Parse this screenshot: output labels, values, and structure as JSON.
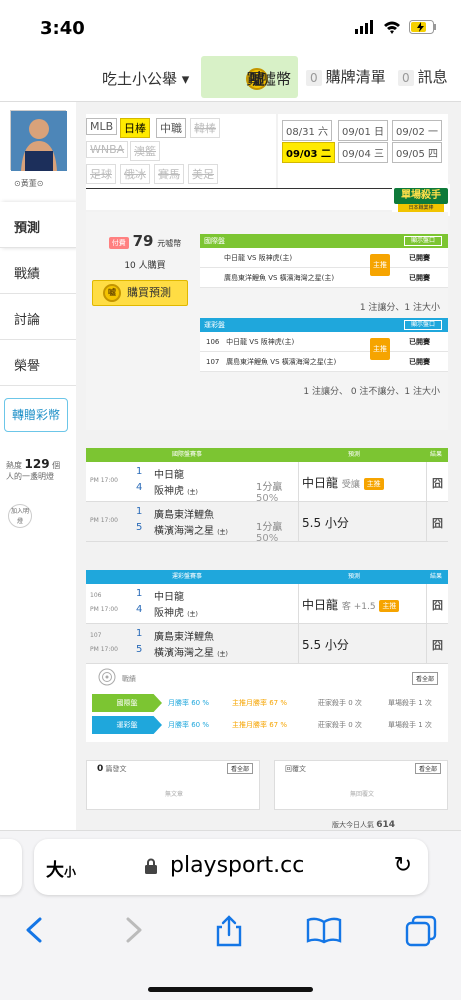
{
  "status": {
    "time": "3:40"
  },
  "topnav": {
    "user": "吃土小公舉 ▾",
    "buy": "買噓幣",
    "cart_count": "0",
    "cart": "購牌清單",
    "msg_count": "0",
    "msg": "訊息",
    "coin_label": "噓"
  },
  "profile": {
    "name": "⊙黃董⊙"
  },
  "sidenav": [
    "預測",
    "戰績",
    "討論",
    "榮譽"
  ],
  "gift": "轉贈彩幣",
  "popularity": {
    "label_pre": "熱度",
    "value": "129",
    "label_post": "個人的一盞明燈",
    "add": "加入明燈"
  },
  "leagues": [
    {
      "label": "MLB",
      "state": "normal"
    },
    {
      "label": "日棒",
      "state": "selected"
    },
    {
      "label": "中職",
      "state": "normal"
    },
    {
      "label": "韓棒",
      "state": "disabled"
    },
    {
      "label": "WNBA",
      "state": "disabled"
    },
    {
      "label": "澳籃",
      "state": "disabled"
    },
    {
      "label": "足球",
      "state": "disabled"
    },
    {
      "label": "俄冰",
      "state": "disabled"
    },
    {
      "label": "賽馬",
      "state": "disabled"
    },
    {
      "label": "美足",
      "state": "disabled"
    }
  ],
  "dates": [
    {
      "label": "08/31 六",
      "selected": false
    },
    {
      "label": "09/01 日",
      "selected": false
    },
    {
      "label": "09/02 一",
      "selected": false
    },
    {
      "label": "09/03 二",
      "selected": true
    },
    {
      "label": "09/04 三",
      "selected": false
    },
    {
      "label": "09/05 四",
      "selected": false
    }
  ],
  "mvp": {
    "title": "單場殺手",
    "sub": "日本職業棒"
  },
  "prediction": {
    "tag": "付費",
    "price": "79",
    "price_unit": "元噓幣",
    "buyers": "10 人購買",
    "buy_button": "購買預測",
    "intl": {
      "title": "國際盤",
      "show": "顯示盤口",
      "rows": [
        {
          "match": "中日龍 VS 阪神虎(主)",
          "tag": "主推",
          "status": "已開賽"
        },
        {
          "match": "廣島東洋鯉魚 VS 橫濱海灣之星(主)",
          "tag": "",
          "status": "已開賽"
        }
      ],
      "summary": "1 注讓分、1 注大小"
    },
    "lottery": {
      "title": "運彩盤",
      "show": "顯示盤口",
      "rows": [
        {
          "no": "106",
          "match": "中日龍 VS 阪神虎(主)",
          "tag": "主推",
          "status": "已開賽"
        },
        {
          "no": "107",
          "match": "廣島東洋鯉魚 VS 橫濱海灣之星(主)",
          "tag": "",
          "status": "已開賽"
        }
      ],
      "summary": "1 注讓分、 0 注不讓分、1 注大小"
    }
  },
  "intl_table": {
    "headers": [
      "國際盤賽事",
      "預測",
      "結果"
    ],
    "rows": [
      {
        "time": "PM 17:00",
        "n1": "1",
        "t1": "中日龍",
        "n2": "4",
        "t2": "阪神虎",
        "t2tag": "(主)",
        "r1": "1分贏",
        "r2": "50%",
        "pick": "中日龍",
        "pick_sub": "受讓",
        "pick_tag": "主推",
        "result": "囧"
      },
      {
        "time": "PM 17:00",
        "n1": "1",
        "t1": "廣島東洋鯉魚",
        "n2": "5",
        "t2": "橫濱海灣之星",
        "t2tag": "(主)",
        "r1": "1分贏",
        "r2": "50%",
        "pick": "5.5 小分",
        "pick_sub": "",
        "pick_tag": "",
        "result": "囧"
      }
    ]
  },
  "lottery_table": {
    "headers": [
      "運彩盤賽事",
      "預測",
      "結果"
    ],
    "rows": [
      {
        "no": "106",
        "time": "PM 17:00",
        "n1": "1",
        "t1": "中日龍",
        "n2": "4",
        "t2": "阪神虎",
        "t2tag": "(主)",
        "pick": "中日龍",
        "pick_sub": "客 +1.5",
        "pick_tag": "主推",
        "result": "囧"
      },
      {
        "no": "107",
        "time": "PM 17:00",
        "n1": "1",
        "t1": "廣島東洋鯉魚",
        "n2": "5",
        "t2": "橫濱海灣之星",
        "t2tag": "(主)",
        "pick": "5.5 小分",
        "pick_sub": "",
        "pick_tag": "",
        "result": "囧"
      }
    ]
  },
  "record": {
    "title": "戰績",
    "all": "看全部",
    "rows": [
      {
        "label": "國際盤",
        "c1": "月勝率 60 %",
        "c2": "主推月勝率 67 %",
        "c3": "莊家殺手 0 次",
        "c4": "單場殺手 1 次"
      },
      {
        "label": "運彩盤",
        "c1": "月勝率 60 %",
        "c2": "主推月勝率 67 %",
        "c3": "莊家殺手 0 次",
        "c4": "單場殺手 1 次"
      }
    ]
  },
  "posts": {
    "left": {
      "count": "0",
      "label": "篇發文",
      "all": "看全部",
      "empty": "無文章"
    },
    "right": {
      "label": "回覆文",
      "all": "看全部",
      "empty": "無回覆文"
    }
  },
  "visitors": {
    "label": "版大今日人氣",
    "value": "614"
  },
  "safari": {
    "aa": "大",
    "aa_small": "小",
    "url": "playsport.cc"
  },
  "colors": {
    "green": "#7cc532",
    "blue": "#1fa7dc",
    "yellow": "#ffea00",
    "orange": "#f6a400"
  }
}
